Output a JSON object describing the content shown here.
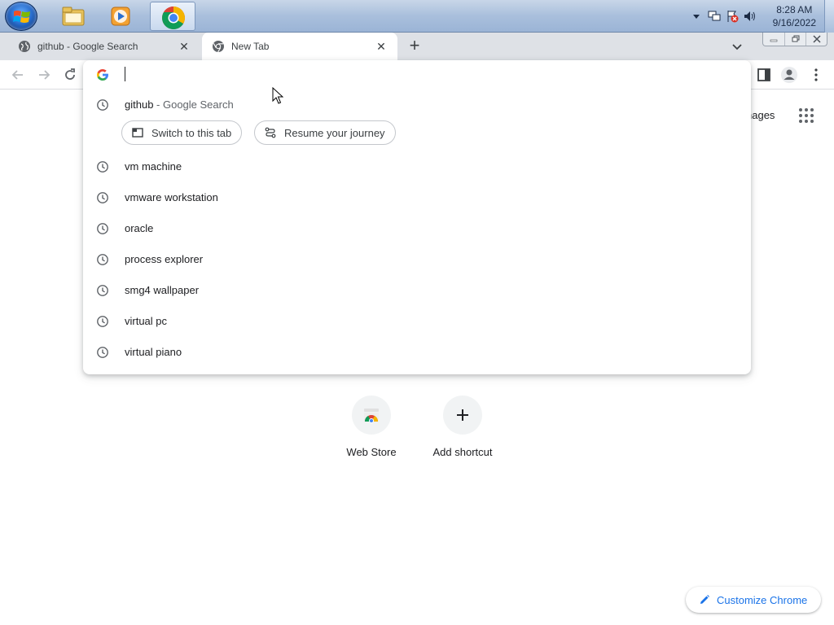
{
  "taskbar": {
    "apps": [
      {
        "name": "Windows Explorer",
        "icon": "folder-icon"
      },
      {
        "name": "Windows Media Player",
        "icon": "media-player-icon"
      },
      {
        "name": "Google Chrome",
        "icon": "chrome-icon",
        "active": true
      }
    ],
    "clock": {
      "time": "8:28 AM",
      "date": "9/16/2022"
    }
  },
  "tabs": [
    {
      "title": "github - Google Search",
      "favicon": "globe-icon",
      "active": false
    },
    {
      "title": "New Tab",
      "favicon": "chrome-icon",
      "active": true
    }
  ],
  "toolbar": {
    "omnibox_value": "",
    "icons": [
      "back-icon",
      "forward-icon",
      "reload-icon",
      "side-panel-icon",
      "profile-icon",
      "menu-icon"
    ]
  },
  "omnibox_dropdown": {
    "first": {
      "query": "github",
      "sub": " - Google Search"
    },
    "actions": [
      {
        "label": "Switch to this tab",
        "icon": "switch-tab-icon"
      },
      {
        "label": "Resume your journey",
        "icon": "journey-icon"
      }
    ],
    "history": [
      "vm machine",
      "vmware workstation",
      "oracle",
      "process explorer",
      "smg4 wallpaper",
      "virtual pc",
      "virtual piano"
    ]
  },
  "ntp": {
    "images_link": "nages",
    "shortcuts": [
      {
        "label": "Web Store",
        "icon": "web-store-icon"
      },
      {
        "label": "Add shortcut",
        "icon": "plus-icon"
      }
    ],
    "customize_label": "Customize Chrome"
  },
  "colors": {
    "accent": "#1a73e8",
    "tab_strip": "#dee1e6",
    "text": "#202124"
  }
}
